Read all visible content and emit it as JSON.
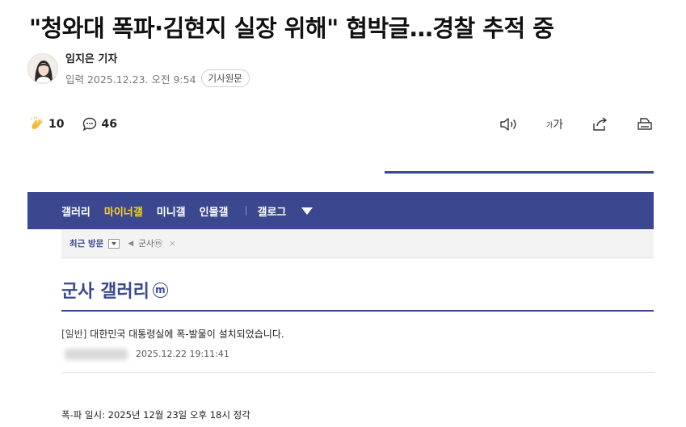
{
  "article": {
    "headline": "\"청와대 폭파·김현지 실장 위해\" 협박글…경찰 추적 중",
    "reporter": "임지은 기자",
    "date": "입력 2025.12.23. 오전 9:54",
    "original_button": "기사원문"
  },
  "actions": {
    "clap_count": "10",
    "comment_count": "46",
    "font_size_label": "가",
    "font_size_small": "가"
  },
  "embedded_screenshot": {
    "nav_items": [
      "갤러리",
      "마이너갤",
      "미니갤",
      "인물갤"
    ],
    "nav_log": "갤로그",
    "recent_label": "최근 방문",
    "recent_item": "군사ⓜ",
    "recent_close": "×",
    "gallery_title": "군사 갤러리",
    "gallery_badge": "m",
    "post_head": "[일반]",
    "post_title": "대한민국 대통령실에 폭-발물이 설치되었습니다.",
    "post_date": "2025.12.22 19:11:41",
    "post_body": "폭-파 일시: 2025년 12월 23일 오후 18시 정각"
  },
  "colors": {
    "brand_navy": "#3b4890",
    "active_nav": "#ffd21e"
  }
}
